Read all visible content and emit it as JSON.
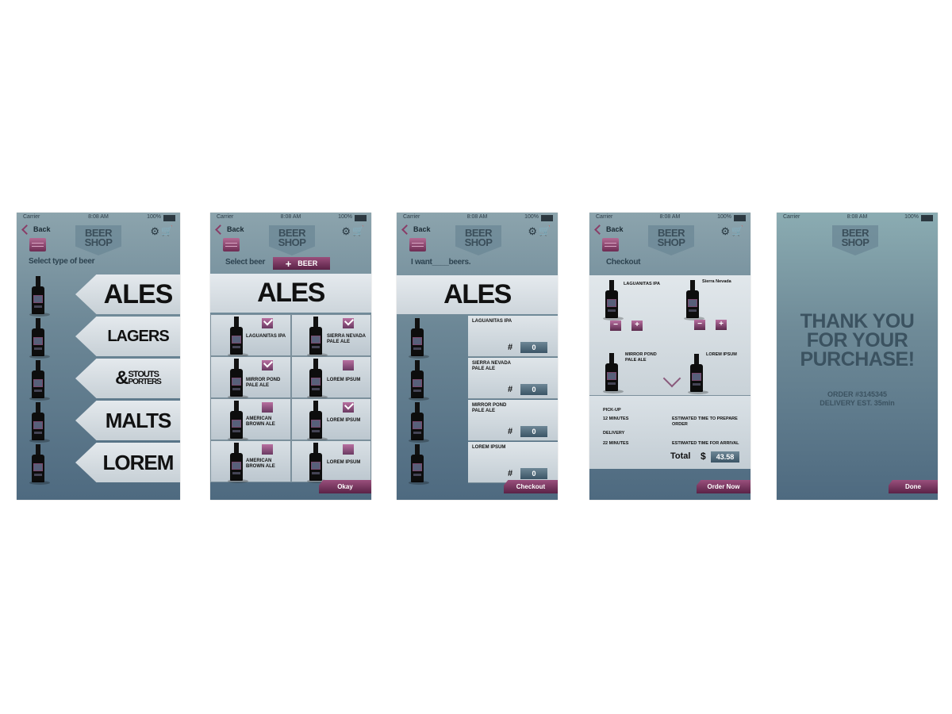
{
  "status": {
    "carrier": "Carrier",
    "time": "8:08 AM",
    "battery": "100%"
  },
  "nav": {
    "back": "Back"
  },
  "logo": {
    "line1": "BEER",
    "line2": "SHOP"
  },
  "screen1": {
    "subtitle": "Select type of beer",
    "types": [
      {
        "label": "ALES"
      },
      {
        "label": "LAGERS"
      },
      {
        "label_amp": "&",
        "label_a": "STOUTS",
        "label_b": "PORTERS"
      },
      {
        "label": "MALTS"
      },
      {
        "label": "LOREM"
      }
    ]
  },
  "screen2": {
    "subtitle": "Select beer",
    "add_button": {
      "plus": "+",
      "label": "BEER"
    },
    "header": "ALES",
    "beers": [
      {
        "name": "LAGUANITAS IPA",
        "checked": true
      },
      {
        "name": "SIERRA NEVADA PALE ALE",
        "checked": true
      },
      {
        "name": "MIRROR POND PALE ALE",
        "checked": true
      },
      {
        "name": "LOREM IPSUM",
        "checked": false
      },
      {
        "name": "AMERICAN BROWN ALE",
        "checked": false
      },
      {
        "name": "LOREM IPSUM",
        "checked": true
      },
      {
        "name": "AMERICAN BROWN ALE",
        "checked": false
      },
      {
        "name": "LOREM IPSUM",
        "checked": false
      }
    ],
    "button": "Okay"
  },
  "screen3": {
    "subtitle": "I want____beers.",
    "header": "ALES",
    "rows": [
      {
        "name": "LAGUANITAS IPA",
        "hash": "#",
        "qty": "0"
      },
      {
        "name": "SIERRA NEVADA PALE ALE",
        "hash": "#",
        "qty": "0"
      },
      {
        "name": "MIRROR POND PALE ALE",
        "hash": "#",
        "qty": "0"
      },
      {
        "name": "LOREM IPSUM",
        "hash": "#",
        "qty": "0"
      }
    ],
    "button": "Checkout"
  },
  "screen4": {
    "subtitle": "Checkout",
    "items": [
      {
        "name": "LAGUANITAS IPA"
      },
      {
        "name": "Sierra Nevada"
      },
      {
        "name": "MIRROR POND PALE ALE"
      },
      {
        "name": "LOREM IPSUM"
      }
    ],
    "minus": "−",
    "plus": "+",
    "pickup_label": "PICK-UP",
    "pickup_time": "12 MINUTES",
    "pickup_desc": "ESTIMATED TIME TO PREPARE ORDER",
    "delivery_label": "DELIVERY",
    "delivery_time": "22 MINUTES",
    "delivery_desc": "ESTIMATED TIME FOR ARRIVAL",
    "total_label": "Total",
    "currency": "$",
    "total_value": "43.58",
    "button": "Order Now"
  },
  "screen5": {
    "thanks_1": "THANK YOU",
    "thanks_2": "FOR YOUR",
    "thanks_3": "PURCHASE!",
    "order": "ORDER #3145345",
    "delivery": "DELIVERY EST. 35min",
    "button": "Done"
  },
  "colors": {
    "accent": "#7a3560",
    "panel": "#d5dde2",
    "bg_top": "#8ca4ad",
    "bg_bottom": "#4e6a80"
  }
}
